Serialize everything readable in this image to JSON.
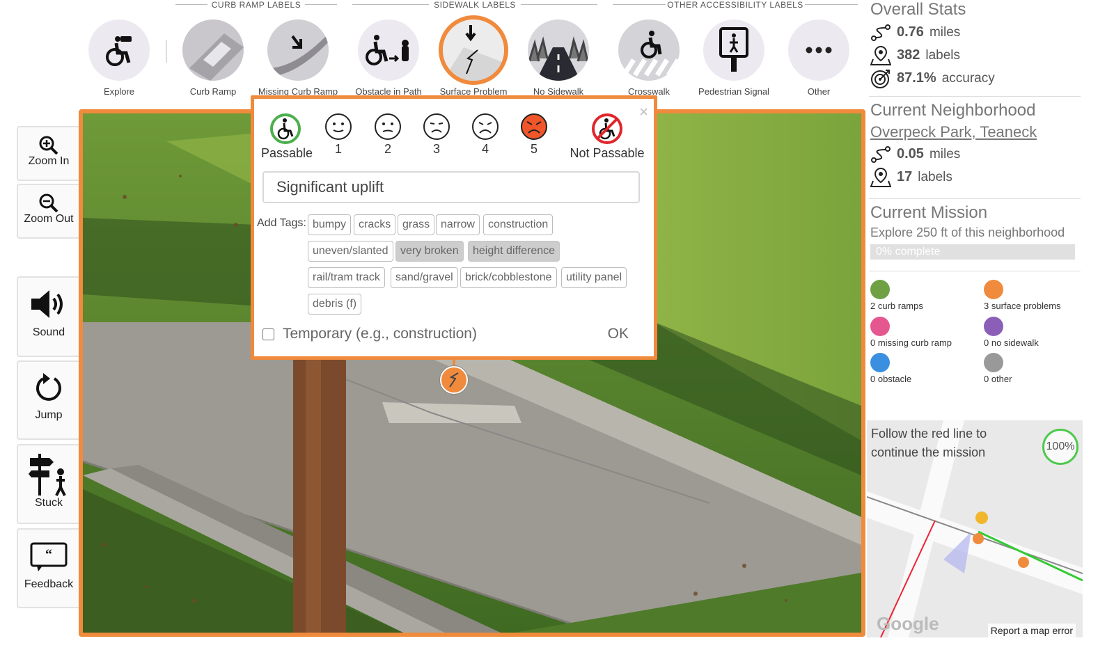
{
  "toolbar": {
    "groups": [
      "CURB RAMP LABELS",
      "SIDEWALK LABELS",
      "OTHER ACCESSIBILITY LABELS"
    ],
    "tools": [
      {
        "label": "Explore",
        "icon": "binoculars-wheelchair-icon"
      },
      {
        "label": "Curb Ramp",
        "icon": "curb-ramp-icon"
      },
      {
        "label": "Missing Curb Ramp",
        "icon": "missing-curb-ramp-icon"
      },
      {
        "label": "Obstacle in Path",
        "icon": "obstacle-icon"
      },
      {
        "label": "Surface Problem",
        "icon": "surface-problem-icon",
        "selected": true
      },
      {
        "label": "No Sidewalk",
        "icon": "no-sidewalk-icon"
      },
      {
        "label": "Crosswalk",
        "icon": "crosswalk-icon"
      },
      {
        "label": "Pedestrian Signal",
        "icon": "pedestrian-signal-icon"
      },
      {
        "label": "Other",
        "icon": "more-icon"
      }
    ]
  },
  "left_controls": [
    {
      "label": "Zoom In",
      "icon": "zoom-in-icon"
    },
    {
      "label": "Zoom Out",
      "icon": "zoom-out-icon"
    },
    {
      "label": "Sound",
      "icon": "speaker-icon"
    },
    {
      "label": "Jump",
      "icon": "refresh-arrow-icon"
    },
    {
      "label": "Stuck",
      "icon": "signpost-person-icon"
    },
    {
      "label": "Feedback",
      "icon": "speech-bubble-icon"
    }
  ],
  "popup": {
    "severity": [
      {
        "label": "Passable",
        "icon": "wheelchair-passable-icon"
      },
      {
        "label": "1",
        "icon": "face-smile-icon"
      },
      {
        "label": "2",
        "icon": "face-neutral-icon"
      },
      {
        "label": "3",
        "icon": "face-frown-icon"
      },
      {
        "label": "4",
        "icon": "face-sad-icon"
      },
      {
        "label": "5",
        "icon": "face-angry-icon",
        "selected": true
      },
      {
        "label": "Not Passable",
        "icon": "wheelchair-not-passable-icon"
      }
    ],
    "close": "×",
    "description": "Significant uplift",
    "add_tags_label": "Add Tags:",
    "tags": [
      {
        "label": "bumpy",
        "active": false
      },
      {
        "label": "cracks",
        "active": false
      },
      {
        "label": "grass",
        "active": false
      },
      {
        "label": "narrow",
        "active": false
      },
      {
        "label": "construction",
        "active": false
      },
      {
        "label": "uneven/slanted",
        "active": false
      },
      {
        "label": "very broken",
        "active": true
      },
      {
        "label": "height difference",
        "active": true
      },
      {
        "label": "rail/tram track",
        "active": false
      },
      {
        "label": "sand/gravel",
        "active": false
      },
      {
        "label": "brick/cobblestone",
        "active": false
      },
      {
        "label": "utility panel",
        "active": false
      },
      {
        "label": "debris (f)",
        "active": false
      }
    ],
    "temporary_label": "Temporary (e.g., construction)",
    "temporary_checked": false,
    "ok_label": "OK"
  },
  "sidebar": {
    "overall": {
      "title": "Overall Stats",
      "miles_value": "0.76",
      "miles_unit": "miles",
      "labels_value": "382",
      "labels_unit": "labels",
      "accuracy_value": "87.1%",
      "accuracy_unit": "accuracy"
    },
    "neighborhood": {
      "title": "Current Neighborhood",
      "name": "Overpeck Park, Teaneck",
      "miles_value": "0.05",
      "miles_unit": "miles",
      "labels_value": "17",
      "labels_unit": "labels"
    },
    "mission": {
      "title": "Current Mission",
      "description": "Explore 250 ft of this neighborhood",
      "progress_text": "0% complete",
      "progress": 0
    },
    "legend": [
      {
        "label": "2 curb ramps",
        "color": "#6fa043"
      },
      {
        "label": "3 surface problems",
        "color": "#f08a3c"
      },
      {
        "label": "0 missing curb ramp",
        "color": "#e4578f"
      },
      {
        "label": "0 no sidewalk",
        "color": "#8b5fb8"
      },
      {
        "label": "0 obstacle",
        "color": "#3a8fe0"
      },
      {
        "label": "0 other",
        "color": "#999999"
      }
    ]
  },
  "minimap": {
    "instruction": "Follow the red line to continue the mission",
    "percent": "100%",
    "report": "Report a map error",
    "brand": "Google"
  },
  "colors": {
    "accent": "#f08a3c",
    "passable": "#4cae4c",
    "not_passable": "#e0262d"
  }
}
